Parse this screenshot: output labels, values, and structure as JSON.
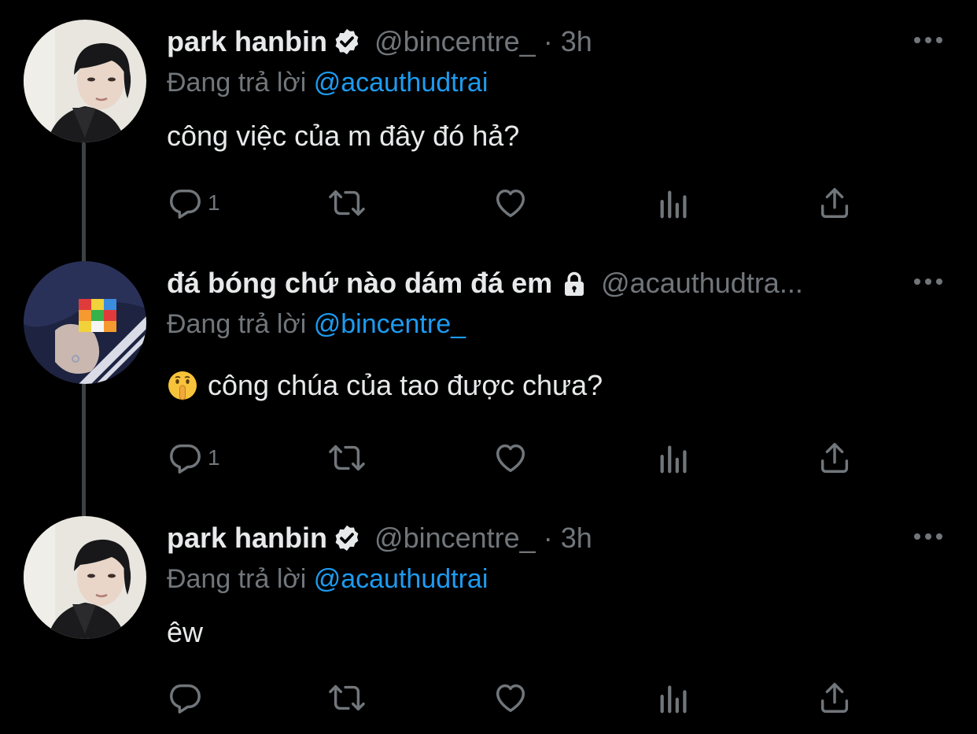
{
  "colors": {
    "background": "#000000",
    "text_primary": "#e7e9ea",
    "text_secondary": "#71767b",
    "link": "#1d9bf0",
    "thread_line": "#3e4144"
  },
  "tweets": [
    {
      "name": "park hanbin",
      "badge": "verified-badge-icon",
      "handle": "@bincentre_",
      "separator": "·",
      "time": "3h",
      "reply_prefix": "Đang trả lời",
      "reply_mention": "@acauthudtrai",
      "text": "công việc của m đây đó hả?",
      "emoji": "",
      "reply_count": "1",
      "more_icon": "more-horizontal-icon"
    },
    {
      "name": "đá bóng chứ nào dám đá em",
      "badge": "lock-icon",
      "handle": "@acauthudtra...",
      "separator": "",
      "time": "",
      "reply_prefix": "Đang trả lời",
      "reply_mention": "@bincentre_",
      "text": "công chúa của tao được chưa?",
      "emoji": "shushing-face-emoji",
      "reply_count": "1",
      "more_icon": "more-horizontal-icon"
    },
    {
      "name": "park hanbin",
      "badge": "verified-badge-icon",
      "handle": "@bincentre_",
      "separator": "·",
      "time": "3h",
      "reply_prefix": "Đang trả lời",
      "reply_mention": "@acauthudtrai",
      "text": "êw",
      "emoji": "",
      "reply_count": "",
      "more_icon": "more-horizontal-icon"
    }
  ],
  "action_icons": [
    "reply-icon",
    "retweet-icon",
    "like-icon",
    "views-icon",
    "share-icon"
  ]
}
